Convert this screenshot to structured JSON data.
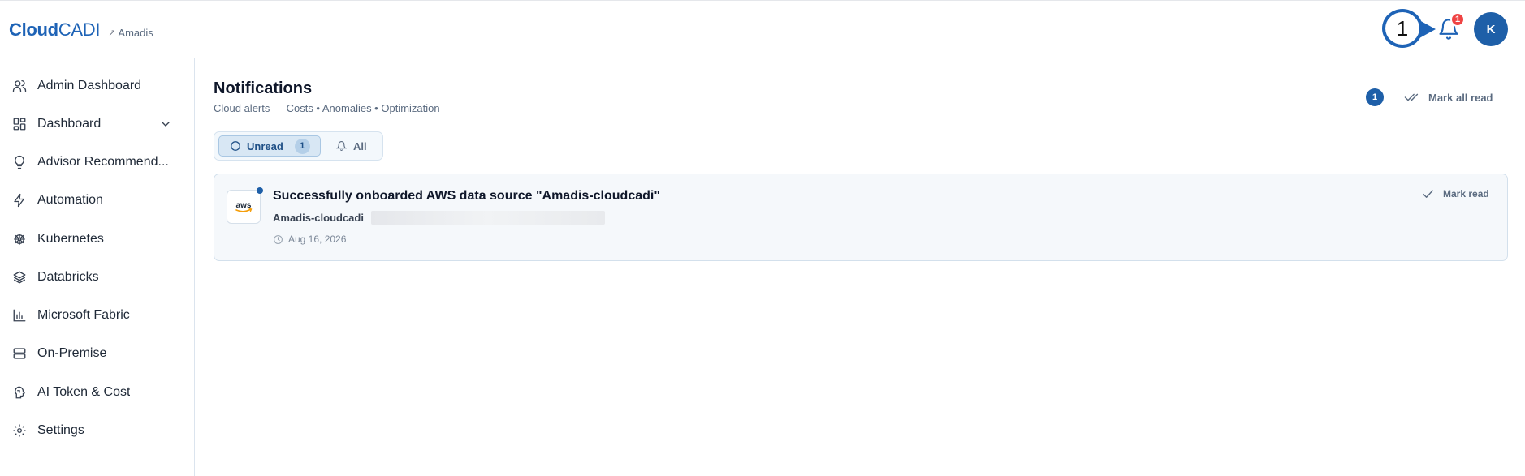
{
  "header": {
    "brand_bold": "Cloud",
    "brand_light": "CADI",
    "tenant": "Amadis",
    "step_marker": "1",
    "notification_count": "1",
    "avatar_initial": "K"
  },
  "sidebar": {
    "items": [
      {
        "label": "Admin Dashboard",
        "icon": "users-icon"
      },
      {
        "label": "Dashboard",
        "icon": "dashboard-grid-icon"
      },
      {
        "label": "Advisor Recommend...",
        "icon": "lightbulb-icon"
      },
      {
        "label": "Automation",
        "icon": "lightning-icon"
      },
      {
        "label": "Kubernetes",
        "icon": "helm-wheel-icon"
      },
      {
        "label": "Databricks",
        "icon": "layers-icon"
      },
      {
        "label": "Microsoft Fabric",
        "icon": "bar-chart-icon"
      },
      {
        "label": "On-Premise",
        "icon": "server-icon"
      },
      {
        "label": "AI Token & Cost",
        "icon": "ai-head-icon"
      },
      {
        "label": "Settings",
        "icon": "gear-icon"
      }
    ]
  },
  "main": {
    "title": "Notifications",
    "subtitle": "Cloud alerts — Costs • Anomalies • Optimization",
    "unread_count": "1",
    "mark_all_label": "Mark all read",
    "tabs": {
      "unread_label": "Unread",
      "unread_count": "1",
      "all_label": "All"
    },
    "notifications": [
      {
        "title": "Successfully onboarded AWS data source \"Amadis-cloudcadi\"",
        "source": "Amadis-cloudcadi",
        "date": "Aug 16, 2026",
        "logo_text": "aws",
        "action_label": "Mark read"
      }
    ]
  },
  "colors": {
    "brand": "#1e63b6",
    "badge_red": "#ef4444",
    "accent_dark": "#1e5fa8"
  }
}
